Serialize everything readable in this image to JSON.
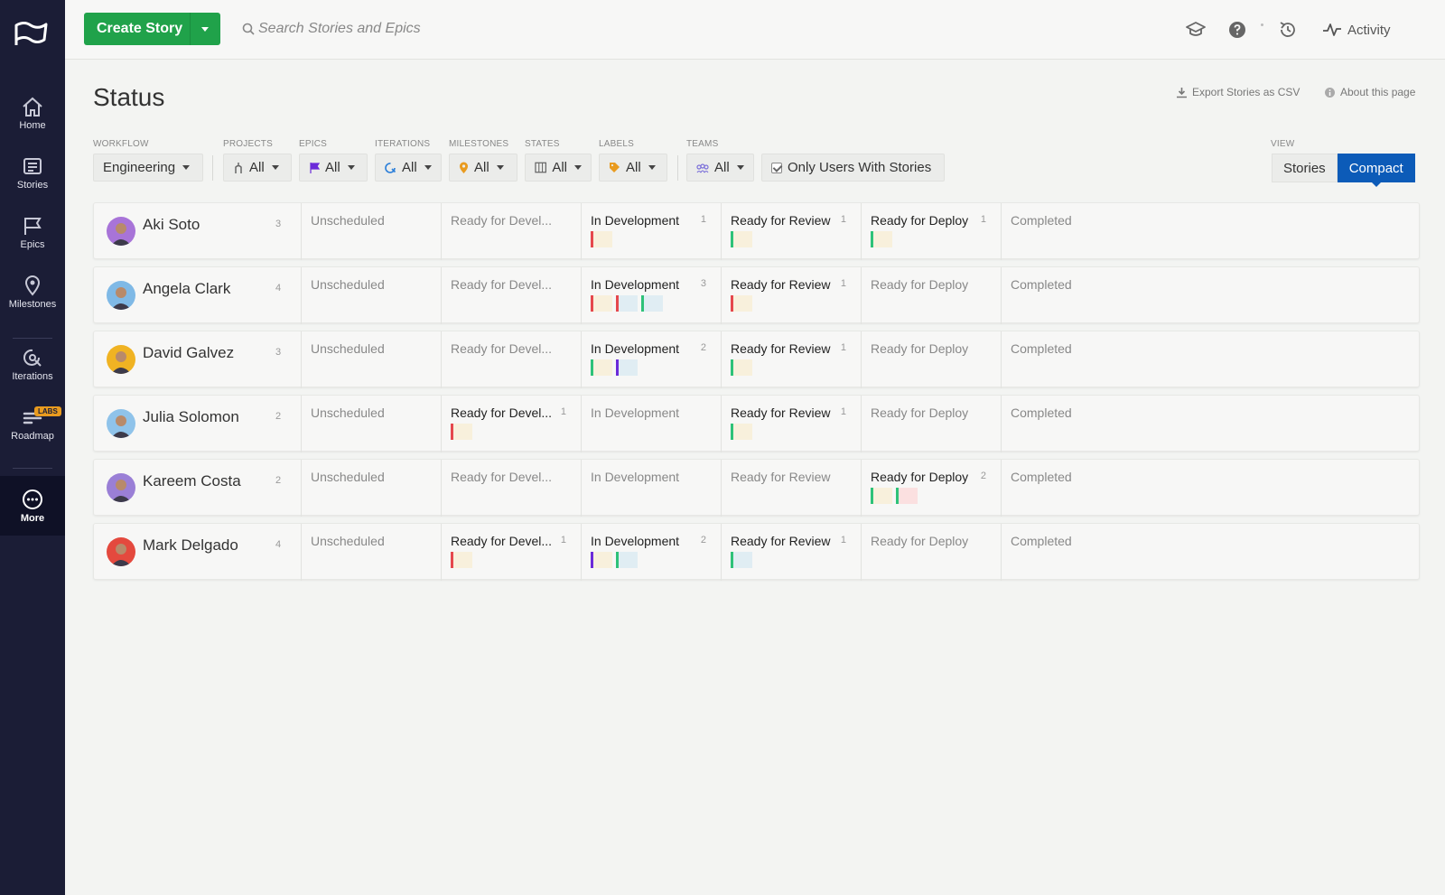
{
  "nav": {
    "items": [
      {
        "label": "Home",
        "icon": "home-icon"
      },
      {
        "label": "Stories",
        "icon": "stories-icon"
      },
      {
        "label": "Epics",
        "icon": "epics-icon"
      },
      {
        "label": "Milestones",
        "icon": "milestones-icon"
      },
      {
        "label": "Iterations",
        "icon": "iterations-icon"
      },
      {
        "label": "Roadmap",
        "icon": "roadmap-icon",
        "badge": "LABS"
      },
      {
        "label": "More",
        "icon": "more-icon"
      }
    ]
  },
  "topbar": {
    "create_label": "Create Story",
    "search_placeholder": "Search Stories and Epics",
    "activity_label": "Activity"
  },
  "page": {
    "title": "Status",
    "export_label": "Export Stories as CSV",
    "about_label": "About this page"
  },
  "filters": {
    "workflow": {
      "label": "WORKFLOW",
      "value": "Engineering"
    },
    "projects": {
      "label": "PROJECTS",
      "value": "All"
    },
    "epics": {
      "label": "EPICS",
      "value": "All"
    },
    "iterations": {
      "label": "ITERATIONS",
      "value": "All"
    },
    "milestones": {
      "label": "MILESTONES",
      "value": "All"
    },
    "states": {
      "label": "STATES",
      "value": "All"
    },
    "labels": {
      "label": "LABELS",
      "value": "All"
    },
    "teams": {
      "label": "TEAMS",
      "value": "All"
    },
    "only_users_label": "Only Users With Stories",
    "view": {
      "label": "VIEW",
      "options": [
        "Stories",
        "Compact"
      ],
      "selected": "Compact"
    }
  },
  "colors": {
    "accent": "#0c5bb8",
    "create": "#20a24a",
    "sidebar": "#1b1d36",
    "stripe_green": "#2ec279",
    "stripe_red": "#e5484d",
    "stripe_purple": "#6b2bd9"
  },
  "states": [
    "Unscheduled",
    "Ready for Devel...",
    "In Development",
    "Ready for Review",
    "Ready for Deploy",
    "Completed"
  ],
  "users": [
    {
      "name": "Aki Soto",
      "count": "3",
      "avatar_color": "#a874d8",
      "cells": [
        {
          "count": "",
          "cards": []
        },
        {
          "count": "",
          "cards": []
        },
        {
          "count": "1",
          "cards": [
            {
              "stripe": "red",
              "bg": "yellow"
            }
          ]
        },
        {
          "count": "1",
          "cards": [
            {
              "stripe": "green",
              "bg": "yellow"
            }
          ]
        },
        {
          "count": "1",
          "cards": [
            {
              "stripe": "green",
              "bg": "yellow"
            }
          ]
        },
        {
          "count": "",
          "cards": []
        }
      ]
    },
    {
      "name": "Angela Clark",
      "count": "4",
      "avatar_color": "#7fb9e6",
      "cells": [
        {
          "count": "",
          "cards": []
        },
        {
          "count": "",
          "cards": []
        },
        {
          "count": "3",
          "cards": [
            {
              "stripe": "red",
              "bg": "yellow"
            },
            {
              "stripe": "red",
              "bg": "blue"
            },
            {
              "stripe": "green",
              "bg": "blue"
            }
          ]
        },
        {
          "count": "1",
          "cards": [
            {
              "stripe": "red",
              "bg": "yellow"
            }
          ]
        },
        {
          "count": "",
          "cards": []
        },
        {
          "count": "",
          "cards": []
        }
      ]
    },
    {
      "name": "David Galvez",
      "count": "3",
      "avatar_color": "#f0b323",
      "cells": [
        {
          "count": "",
          "cards": []
        },
        {
          "count": "",
          "cards": []
        },
        {
          "count": "2",
          "cards": [
            {
              "stripe": "green",
              "bg": "yellow"
            },
            {
              "stripe": "purple",
              "bg": "blue"
            }
          ]
        },
        {
          "count": "1",
          "cards": [
            {
              "stripe": "green",
              "bg": "yellow"
            }
          ]
        },
        {
          "count": "",
          "cards": []
        },
        {
          "count": "",
          "cards": []
        }
      ]
    },
    {
      "name": "Julia Solomon",
      "count": "2",
      "avatar_color": "#8fc3ea",
      "cells": [
        {
          "count": "",
          "cards": []
        },
        {
          "count": "1",
          "cards": [
            {
              "stripe": "red",
              "bg": "yellow"
            }
          ]
        },
        {
          "count": "",
          "cards": []
        },
        {
          "count": "1",
          "cards": [
            {
              "stripe": "green",
              "bg": "yellow"
            }
          ]
        },
        {
          "count": "",
          "cards": []
        },
        {
          "count": "",
          "cards": []
        }
      ]
    },
    {
      "name": "Kareem Costa",
      "count": "2",
      "avatar_color": "#9a7fd6",
      "cells": [
        {
          "count": "",
          "cards": []
        },
        {
          "count": "",
          "cards": []
        },
        {
          "count": "",
          "cards": []
        },
        {
          "count": "",
          "cards": []
        },
        {
          "count": "2",
          "cards": [
            {
              "stripe": "green",
              "bg": "yellow"
            },
            {
              "stripe": "green",
              "bg": "pink"
            }
          ]
        },
        {
          "count": "",
          "cards": []
        }
      ]
    },
    {
      "name": "Mark Delgado",
      "count": "4",
      "avatar_color": "#e4493e",
      "cells": [
        {
          "count": "",
          "cards": []
        },
        {
          "count": "1",
          "cards": [
            {
              "stripe": "red",
              "bg": "yellow"
            }
          ]
        },
        {
          "count": "2",
          "cards": [
            {
              "stripe": "purple",
              "bg": "yellow"
            },
            {
              "stripe": "green",
              "bg": "blue"
            }
          ]
        },
        {
          "count": "1",
          "cards": [
            {
              "stripe": "green",
              "bg": "blue"
            }
          ]
        },
        {
          "count": "",
          "cards": []
        },
        {
          "count": "",
          "cards": []
        }
      ]
    }
  ]
}
